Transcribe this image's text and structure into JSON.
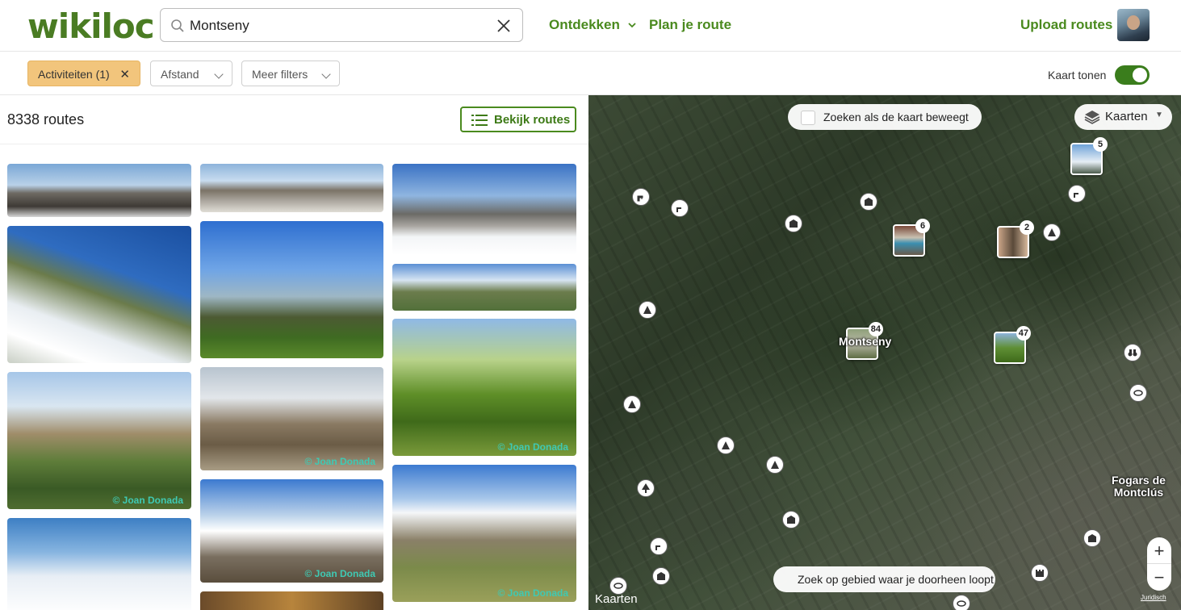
{
  "header": {
    "logo": "wikiloc",
    "search": {
      "value": "Montseny",
      "placeholder": ""
    },
    "nav": {
      "discover": "Ontdekken",
      "plan": "Plan je route",
      "upload": "Upload routes"
    }
  },
  "filters": {
    "activities": "Activiteiten (1)",
    "distance": "Afstand",
    "more": "Meer filters",
    "map_toggle_label": "Kaart tonen",
    "map_toggle_on": true
  },
  "list": {
    "count": "8338 routes",
    "view_button": "Bekijk routes",
    "credit": "© Joan Donada"
  },
  "map": {
    "search_as_move": "Zoeken als de kaart beweegt",
    "layers_button": "Kaarten",
    "search_area": "Zoek op gebied waar je doorheen loopt",
    "zoom_in": "+",
    "zoom_out": "−",
    "attribution": "Kaarten",
    "legal": "Juridisch",
    "place_montseny": "Montseny",
    "place_fogars": "Fogars de\nMontclús",
    "clusters": {
      "a": "5",
      "b": "6",
      "c": "2",
      "d": "84",
      "e": "47"
    }
  },
  "colors": {
    "brand": "#4a8a1e",
    "chip_active": "#f2c57c",
    "credit": "#3fc9b3"
  }
}
